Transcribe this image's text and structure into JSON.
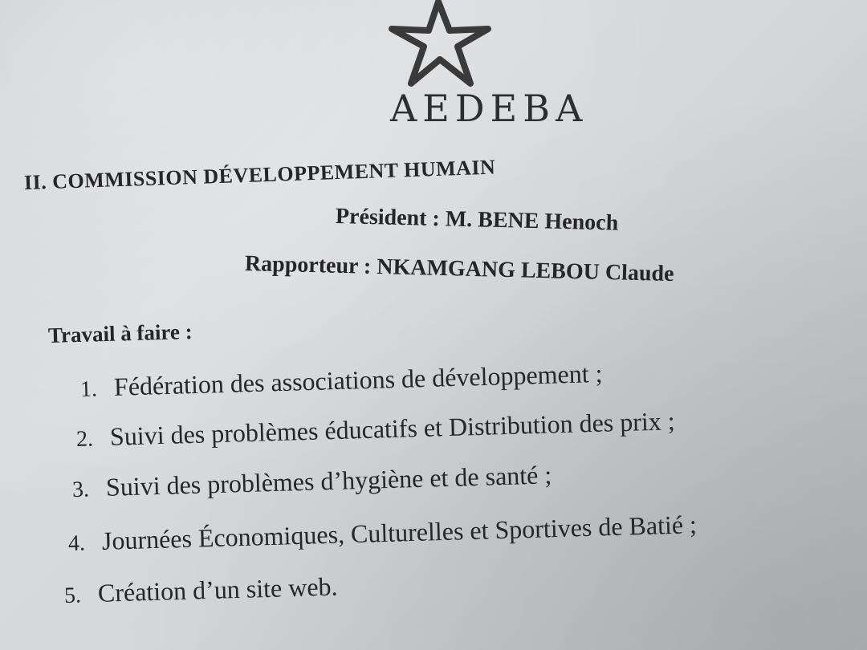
{
  "logo": {
    "text": "AEDEBA",
    "icon": "star-icon"
  },
  "section": {
    "title": "II. COMMISSION DÉVELOPPEMENT HUMAIN"
  },
  "roles": {
    "president": "Président : M. BENE Henoch",
    "rapporteur": "Rapporteur : NKAMGANG LEBOU Claude"
  },
  "todo": {
    "heading": "Travail à faire :",
    "items": [
      {
        "number": "1.",
        "text": "Fédération des associations de développement ;"
      },
      {
        "number": "2.",
        "text": "Suivi des problèmes éducatifs et Distribution des prix ;"
      },
      {
        "number": "3.",
        "text": "Suivi des problèmes d’hygiène et de santé ;"
      },
      {
        "number": "4.",
        "text": "Journées Économiques, Culturelles et Sportives de Batié ;"
      },
      {
        "number": "5.",
        "text": "Création d’un site web."
      }
    ]
  },
  "colors": {
    "paper": "#d4d6da",
    "ink": "#262626"
  }
}
